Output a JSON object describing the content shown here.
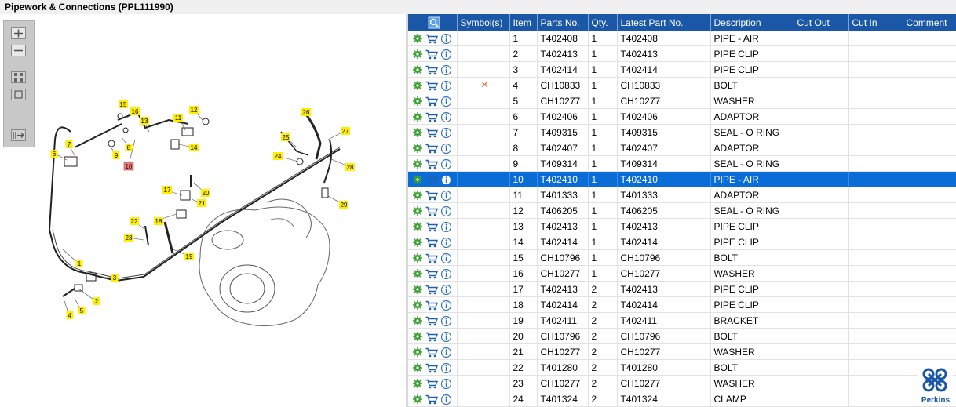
{
  "window": {
    "title": "Pipework & Connections (PPL111990)"
  },
  "toolbar": {
    "buttons": [
      "zoom-in",
      "zoom-out",
      "fit-all",
      "actual-size",
      "export"
    ]
  },
  "diagram": {
    "callouts": [
      "1",
      "2",
      "3",
      "4",
      "5",
      "6",
      "7",
      "8",
      "9",
      "10",
      "11",
      "12",
      "13",
      "14",
      "15",
      "16",
      "17",
      "18",
      "19",
      "20",
      "21",
      "22",
      "23",
      "24",
      "25",
      "26",
      "27",
      "28",
      "29"
    ],
    "highlighted": "10"
  },
  "table": {
    "headers": [
      "",
      "Symbol(s)",
      "Item",
      "Parts No.",
      "Qty.",
      "Latest Part No.",
      "Description",
      "Cut Out",
      "Cut In",
      "Comment"
    ],
    "rows": [
      {
        "symbol": "",
        "item": "1",
        "part": "T402408",
        "qty": "1",
        "latest": "T402408",
        "desc": "PIPE - AIR"
      },
      {
        "symbol": "",
        "item": "2",
        "part": "T402413",
        "qty": "1",
        "latest": "T402413",
        "desc": "PIPE CLIP"
      },
      {
        "symbol": "",
        "item": "3",
        "part": "T402414",
        "qty": "1",
        "latest": "T402414",
        "desc": "PIPE CLIP"
      },
      {
        "symbol": "×",
        "item": "4",
        "part": "CH10833",
        "qty": "1",
        "latest": "CH10833",
        "desc": "BOLT"
      },
      {
        "symbol": "",
        "item": "5",
        "part": "CH10277",
        "qty": "1",
        "latest": "CH10277",
        "desc": "WASHER"
      },
      {
        "symbol": "",
        "item": "6",
        "part": "T402406",
        "qty": "1",
        "latest": "T402406",
        "desc": "ADAPTOR"
      },
      {
        "symbol": "",
        "item": "7",
        "part": "T409315",
        "qty": "1",
        "latest": "T409315",
        "desc": "SEAL - O RING"
      },
      {
        "symbol": "",
        "item": "8",
        "part": "T402407",
        "qty": "1",
        "latest": "T402407",
        "desc": "ADAPTOR"
      },
      {
        "symbol": "",
        "item": "9",
        "part": "T409314",
        "qty": "1",
        "latest": "T409314",
        "desc": "SEAL - O RING"
      },
      {
        "symbol": "",
        "item": "10",
        "part": "T402410",
        "qty": "1",
        "latest": "T402410",
        "desc": "PIPE - AIR"
      },
      {
        "symbol": "",
        "item": "11",
        "part": "T401333",
        "qty": "1",
        "latest": "T401333",
        "desc": "ADAPTOR"
      },
      {
        "symbol": "",
        "item": "12",
        "part": "T406205",
        "qty": "1",
        "latest": "T406205",
        "desc": "SEAL - O RING"
      },
      {
        "symbol": "",
        "item": "13",
        "part": "T402413",
        "qty": "1",
        "latest": "T402413",
        "desc": "PIPE CLIP"
      },
      {
        "symbol": "",
        "item": "14",
        "part": "T402414",
        "qty": "1",
        "latest": "T402414",
        "desc": "PIPE CLIP"
      },
      {
        "symbol": "",
        "item": "15",
        "part": "CH10796",
        "qty": "1",
        "latest": "CH10796",
        "desc": "BOLT"
      },
      {
        "symbol": "",
        "item": "16",
        "part": "CH10277",
        "qty": "1",
        "latest": "CH10277",
        "desc": "WASHER"
      },
      {
        "symbol": "",
        "item": "17",
        "part": "T402413",
        "qty": "2",
        "latest": "T402413",
        "desc": "PIPE CLIP"
      },
      {
        "symbol": "",
        "item": "18",
        "part": "T402414",
        "qty": "2",
        "latest": "T402414",
        "desc": "PIPE CLIP"
      },
      {
        "symbol": "",
        "item": "19",
        "part": "T402411",
        "qty": "2",
        "latest": "T402411",
        "desc": "BRACKET"
      },
      {
        "symbol": "",
        "item": "20",
        "part": "CH10796",
        "qty": "2",
        "latest": "CH10796",
        "desc": "BOLT"
      },
      {
        "symbol": "",
        "item": "21",
        "part": "CH10277",
        "qty": "2",
        "latest": "CH10277",
        "desc": "WASHER"
      },
      {
        "symbol": "",
        "item": "22",
        "part": "T401280",
        "qty": "2",
        "latest": "T401280",
        "desc": "BOLT"
      },
      {
        "symbol": "",
        "item": "23",
        "part": "CH10277",
        "qty": "2",
        "latest": "CH10277",
        "desc": "WASHER"
      },
      {
        "symbol": "",
        "item": "24",
        "part": "T401324",
        "qty": "2",
        "latest": "T401324",
        "desc": "CLAMP"
      }
    ],
    "selected_item": "10"
  },
  "brand": {
    "name": "Perkins"
  },
  "colors": {
    "header_bg": "#1a57a6",
    "selected_row": "#0a6cd6",
    "callout": "#ffee00",
    "callout_highlight": "#f08080",
    "gear_icon": "#3aa032",
    "cart_icon": "#2060b0",
    "info_icon": "#2a70c8",
    "symbol_x": "#e06020"
  }
}
